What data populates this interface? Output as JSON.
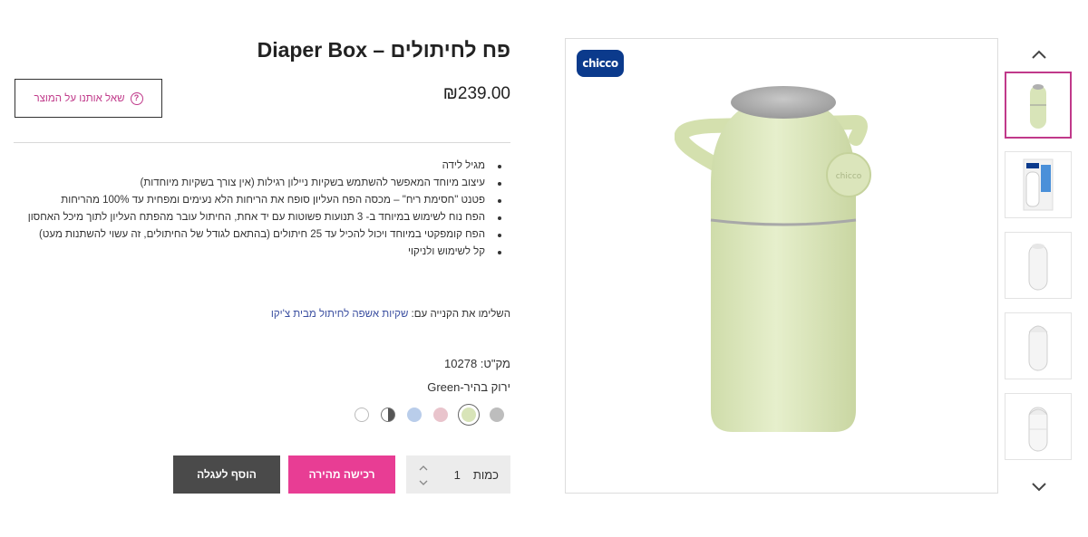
{
  "product": {
    "title": "פח לחיתולים – Diaper Box",
    "price": "₪239.00",
    "ask_label": "שאל אותנו על המוצר",
    "features": [
      "מגיל לידה",
      "עיצוב מיוחד המאפשר להשתמש בשקיות ניילון רגילות (אין צורך בשקיות מיוחדות)",
      "פטנט \"חסימת ריח\" – מכסה הפח העליון סופח את הריחות הלא נעימים ומפחית עד 100% מהריחות",
      "הפח נוח לשימוש במיוחד ב- 3 תנועות פשוטות עם יד אחת, החיתול עובר מהפתח העליון לתוך מיכל האחסון",
      "הפח קומפקטי במיוחד ויכול להכיל עד 25 חיתולים (בהתאם לגודל של החיתולים, זה עשוי להשתנות מעט)",
      "קל לשימוש ולניקוי"
    ],
    "complete_prefix": "השלימו את הקנייה עם: ",
    "complete_link": "שקיות אשפה לחיתול מבית צ'יקו",
    "sku": "מק\"ט: 10278",
    "color_label": "ירוק בהיר-Green",
    "swatches": [
      {
        "color": "#bdbdbd",
        "selected": false
      },
      {
        "color": "#d8e4b8",
        "selected": true
      },
      {
        "color": "#e9c4cc",
        "selected": false
      },
      {
        "color": "#b9cdea",
        "selected": false
      },
      {
        "color": "#6a6a6a",
        "selected": false
      },
      {
        "color": "#ffffff",
        "selected": false
      }
    ],
    "qty_label": "כמות",
    "qty_value": "1",
    "buy_now_label": "רכישה מהירה",
    "add_to_cart_label": "הוסף לעגלה"
  },
  "gallery": {
    "brand_logo": "chicco",
    "thumbnails": [
      "green-bin",
      "package-box",
      "white-bin",
      "white-bin-open",
      "white-bin-side"
    ],
    "active_index": 0
  },
  "colors": {
    "accent": "#e83d94",
    "accent_border": "#c0398a",
    "cart": "#4a4a4a",
    "link": "#3a4ea0"
  }
}
